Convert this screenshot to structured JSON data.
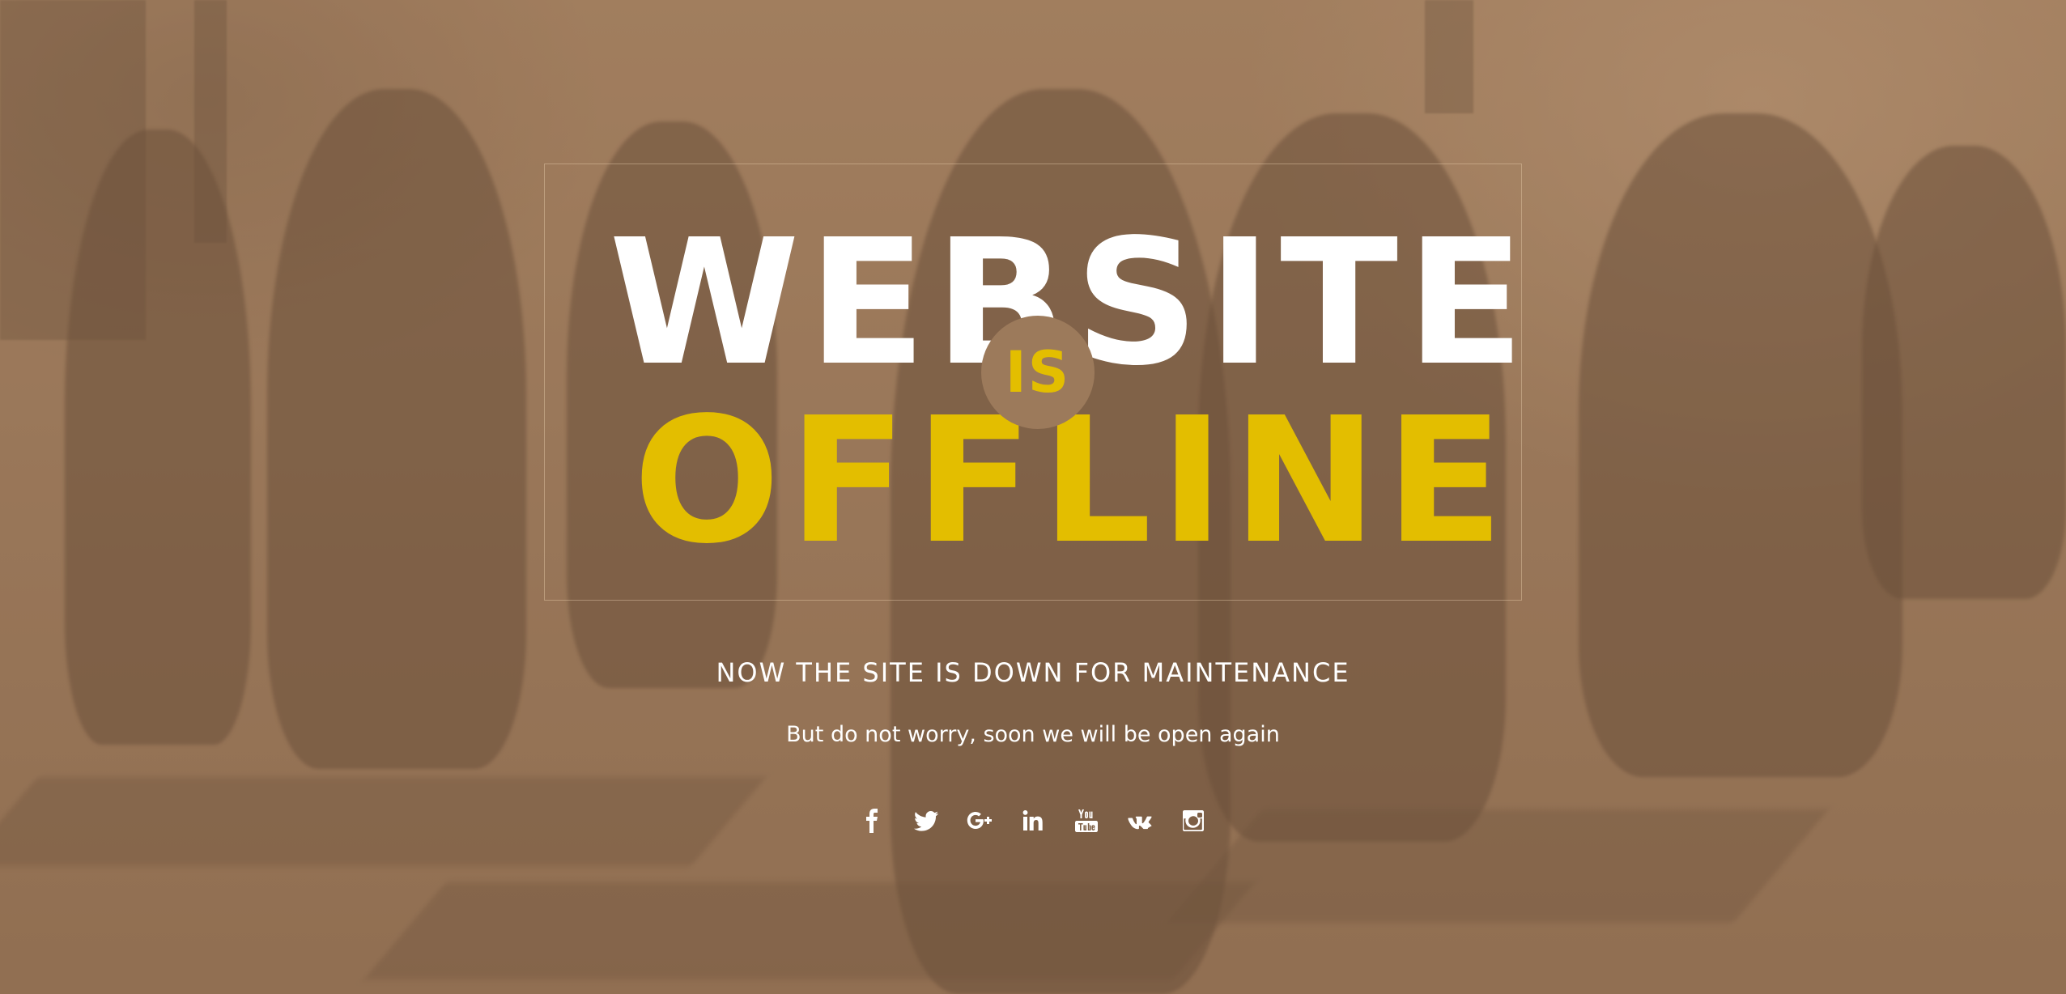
{
  "hero": {
    "line1": "WEBSITE",
    "line2": "IS",
    "line3": "OFFLINE"
  },
  "message": {
    "headline": "NOW THE SITE IS DOWN FOR MAINTENANCE",
    "subline": "But do not worry, soon we will be open again"
  },
  "social": [
    {
      "name": "facebook",
      "icon": "facebook-icon"
    },
    {
      "name": "twitter",
      "icon": "twitter-icon"
    },
    {
      "name": "google-plus",
      "icon": "google-plus-icon"
    },
    {
      "name": "linkedin",
      "icon": "linkedin-icon"
    },
    {
      "name": "youtube",
      "icon": "youtube-icon"
    },
    {
      "name": "vk",
      "icon": "vk-icon"
    },
    {
      "name": "instagram",
      "icon": "instagram-icon"
    }
  ],
  "colors": {
    "accent": "#e3be00",
    "text": "#ffffff",
    "background": "#9c7a5b"
  }
}
